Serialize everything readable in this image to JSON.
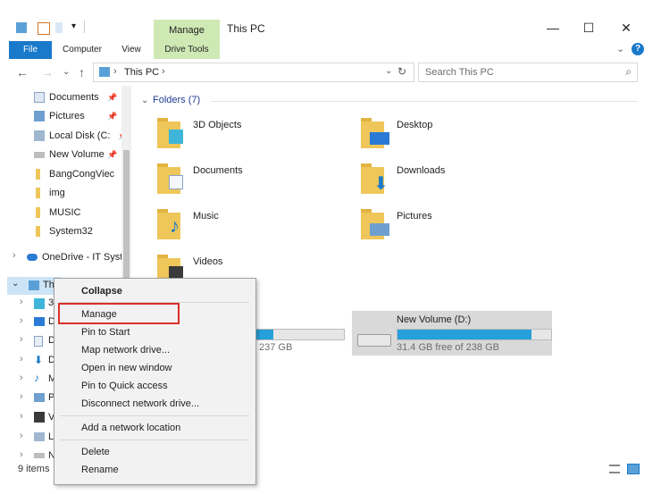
{
  "window": {
    "title": "This PC",
    "context_tab_group": "Manage",
    "controls": [
      "—",
      "☐",
      "✕"
    ]
  },
  "ribbon": {
    "tabs": [
      "File",
      "Computer",
      "View",
      "Drive Tools"
    ]
  },
  "address": {
    "path": "This PC",
    "search_placeholder": "Search This PC"
  },
  "nav": {
    "items": [
      {
        "label": "Documents",
        "pinned": true,
        "icon": "documents-icon"
      },
      {
        "label": "Pictures",
        "pinned": true,
        "icon": "pictures-icon"
      },
      {
        "label": "Local Disk (C:",
        "pinned": true,
        "icon": "local-disk-icon"
      },
      {
        "label": "New Volume",
        "pinned": true,
        "icon": "drive-icon"
      },
      {
        "label": "BangCongViec",
        "pinned": false,
        "icon": "folder-icon"
      },
      {
        "label": "img",
        "pinned": false,
        "icon": "folder-icon"
      },
      {
        "label": "MUSIC",
        "pinned": false,
        "icon": "folder-icon"
      },
      {
        "label": "System32",
        "pinned": false,
        "icon": "folder-icon"
      }
    ],
    "onedrive": "OneDrive - IT Syst",
    "thispc": "This PC",
    "thispc_visible": "Thi",
    "subitems": [
      "3",
      "D",
      "D",
      "D",
      "M",
      "P",
      "V",
      "L",
      "N"
    ]
  },
  "content": {
    "folders_header": "Folders (7)",
    "folders": [
      "3D Objects",
      "Desktop",
      "Documents",
      "Downloads",
      "Music",
      "Pictures",
      "Videos"
    ],
    "drive_c_free": "237 GB",
    "drive_c_used_fraction": 0.35,
    "drive_d": {
      "name": "New Volume (D:)",
      "free_text": "31.4 GB free of 238 GB",
      "used_fraction": 0.87
    }
  },
  "context_menu": {
    "items": [
      "Collapse",
      "Manage",
      "Pin to Start",
      "Map network drive...",
      "Open in new window",
      "Pin to Quick access",
      "Disconnect network drive...",
      "Add a network location",
      "Delete",
      "Rename"
    ]
  },
  "status": {
    "items_count": "9 items"
  },
  "colors": {
    "accent": "#1979ca",
    "manage_tab": "#cfe9b5",
    "highlight": "#d9302a",
    "progress": "#26a0da"
  }
}
